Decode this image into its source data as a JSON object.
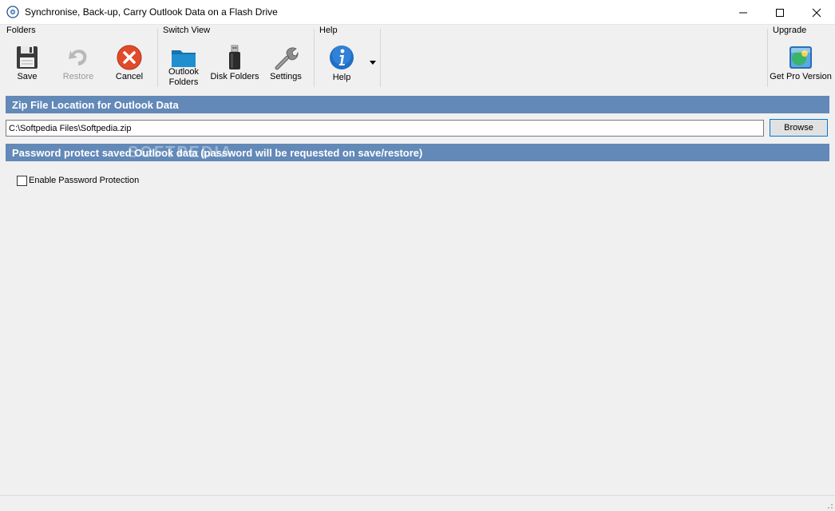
{
  "window": {
    "title": "Synchronise, Back-up, Carry Outlook Data on a Flash Drive"
  },
  "ribbon": {
    "folders": {
      "title": "Folders",
      "save_label": "Save",
      "restore_label": "Restore",
      "cancel_label": "Cancel"
    },
    "switch_view": {
      "title": "Switch View",
      "outlook_folders_line1": "Outlook",
      "outlook_folders_line2": "Folders",
      "disk_folders_label": "Disk Folders",
      "settings_label": "Settings"
    },
    "help": {
      "title": "Help",
      "help_label": "Help"
    },
    "upgrade": {
      "title": "Upgrade",
      "get_pro_label": "Get Pro Version"
    }
  },
  "zip_section": {
    "header": "Zip File Location for Outlook Data",
    "path_value": "C:\\Softpedia Files\\Softpedia.zip",
    "browse_label": "Browse"
  },
  "password_section": {
    "header": "Password protect saved Outlook data (password will be requested on save/restore)",
    "enable_label": "Enable Password Protection",
    "enabled": false
  },
  "watermark": "SOFTPEDIA",
  "icons": {
    "app": "backup-disc-icon",
    "save": "floppy-disk-icon",
    "restore": "restore-arrow-icon",
    "cancel": "cancel-x-icon",
    "outlook_folders": "blue-folder-icon",
    "disk_folders": "usb-drive-icon",
    "settings": "wrench-icon",
    "help": "info-icon",
    "upgrade": "pro-upgrade-icon"
  },
  "colors": {
    "section_header_bg": "#6289b8",
    "cancel_red": "#e04b2b",
    "help_blue": "#1f6fc5",
    "folder_blue": "#1f8fd0"
  }
}
